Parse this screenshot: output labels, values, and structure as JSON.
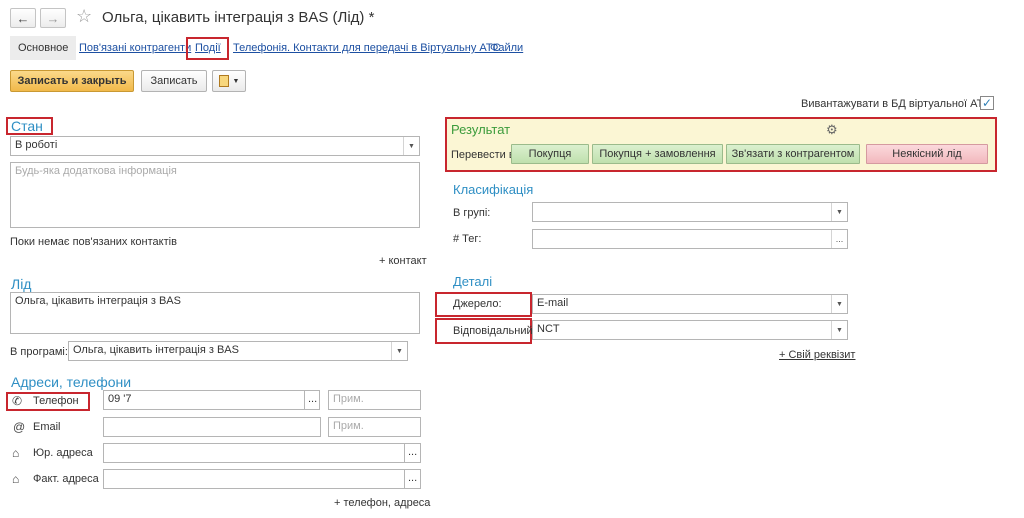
{
  "header": {
    "back_icon": "arrow-left-icon",
    "forward_icon": "arrow-right-icon",
    "star_icon": "star-icon",
    "title": "Ольга, цікавить інтеграція з BAS (Лід) *"
  },
  "tabs": [
    {
      "label": "Основное"
    },
    {
      "label": "Пов'язані контрагенти"
    },
    {
      "label": "Події"
    },
    {
      "label": "Телефонія. Контакти для передачі в Віртуальну АТС"
    },
    {
      "label": "Файли"
    }
  ],
  "toolbar": {
    "save_close": "Записать и закрыть",
    "save": "Записать"
  },
  "export_label": "Вивантажувати в БД віртуальної АТС:",
  "left": {
    "state_title": "Стан",
    "state_value": "В роботі",
    "extra_info_placeholder": "Будь-яка додаткова інформація",
    "no_contacts": "Поки немає пов'язаних контактів",
    "add_contact": "+ контакт",
    "lead_title": "Лід",
    "lead_value": "Ольга, цікавить інтеграція з BAS",
    "program_label": "В програмі:",
    "program_value": "Ольга, цікавить інтеграція з BAS",
    "addresses_title": "Адреси, телефони",
    "phone_label": "Телефон",
    "phone_value": "09           '7",
    "note_placeholder": "Прим.",
    "email_label": "Email",
    "legal_address_label": "Юр. адреса",
    "actual_address_label": "Факт. адреса",
    "add_phone_address": "+ телефон, адреса"
  },
  "result": {
    "title": "Результат",
    "convert_label": "Перевести в:",
    "buttons": [
      "Покупця",
      "Покупця + замовлення",
      "Зв'язати з контрагентом",
      "Неякісний лід"
    ],
    "colors": {
      "green": "#c8e6b8",
      "red": "#f4c4c8",
      "panel": "#fbf6d4"
    }
  },
  "classification": {
    "title": "Класифікація",
    "group_label": "В групі:",
    "tag_label": "# Тег:"
  },
  "details": {
    "title": "Деталі",
    "source_label": "Джерело:",
    "source_value": "E-mail",
    "responsible_label": "Відповідальний:",
    "responsible_value": "NCT",
    "own_attribute": "+ Свій реквізит"
  }
}
